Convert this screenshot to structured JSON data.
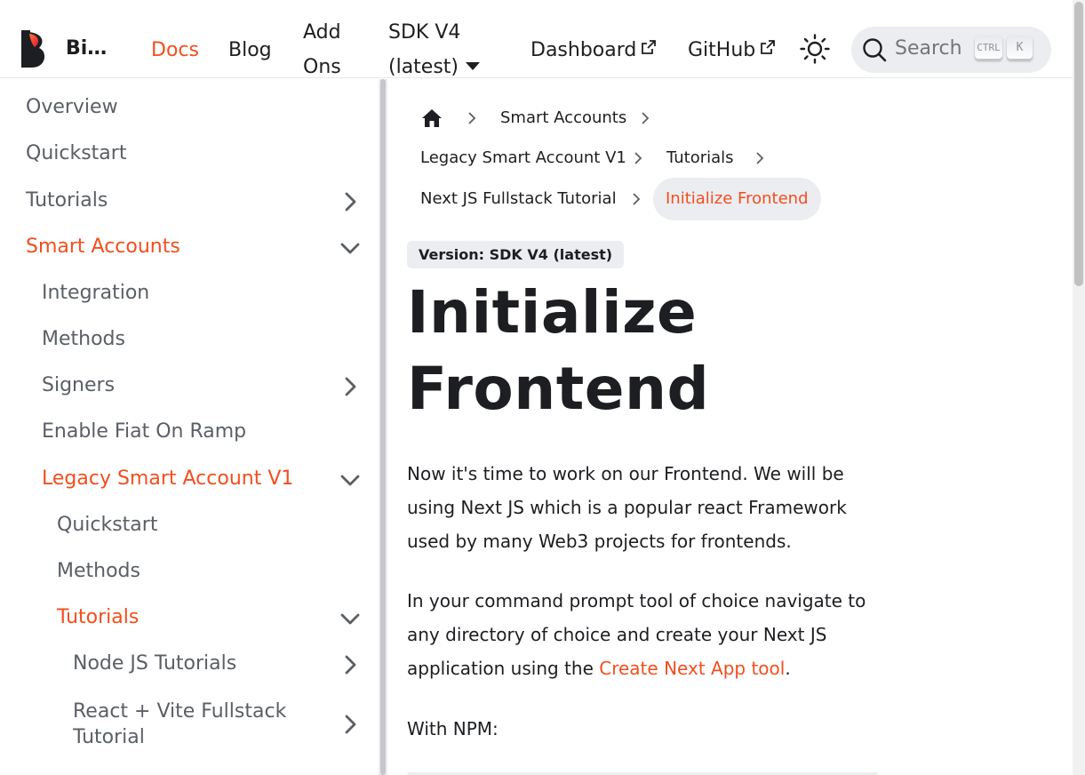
{
  "navbar": {
    "brand": "Bi…",
    "links": {
      "docs": "Docs",
      "blog": "Blog",
      "addons_line1": "Add",
      "addons_line2": "Ons",
      "version_line1": "SDK V4",
      "version_line2": "(latest)",
      "dashboard": "Dashboard",
      "github": "GitHub"
    },
    "search": {
      "placeholder": "Search",
      "key1": "CTRL",
      "key2": "K"
    }
  },
  "sidebar": {
    "items": [
      {
        "label": "Overview"
      },
      {
        "label": "Quickstart"
      },
      {
        "label": "Tutorials"
      },
      {
        "label": "Smart Accounts"
      },
      {
        "label": "Integration"
      },
      {
        "label": "Methods"
      },
      {
        "label": "Signers"
      },
      {
        "label": "Enable Fiat On Ramp"
      },
      {
        "label": "Legacy Smart Account V1"
      },
      {
        "label": "Quickstart"
      },
      {
        "label": "Methods"
      },
      {
        "label": "Tutorials"
      },
      {
        "label": "Node JS Tutorials"
      },
      {
        "label": "React + Vite Fullstack",
        "label2": "Tutorial"
      }
    ]
  },
  "breadcrumb": {
    "items": [
      "Smart Accounts",
      "Legacy Smart Account V1",
      "Tutorials",
      "Next JS Fullstack Tutorial",
      "Initialize Frontend"
    ]
  },
  "content": {
    "version_badge": "Version: SDK V4 (latest)",
    "title_line1": "Initialize",
    "title_line2": "Frontend",
    "p1": "Now it's time to work on our Frontend. We will be using Next JS which is a popular react Framework used by many Web3 projects for frontends.",
    "p2_before": "In your command prompt tool of choice navigate to any directory of choice and create your Next JS application using the ",
    "p2_link": "Create Next App tool",
    "p2_after": ".",
    "p3": "With NPM:"
  },
  "colors": {
    "accent": "#f24e1e",
    "text": "#1c1e21",
    "muted": "#5a5f66",
    "surface": "#ebedf0"
  }
}
